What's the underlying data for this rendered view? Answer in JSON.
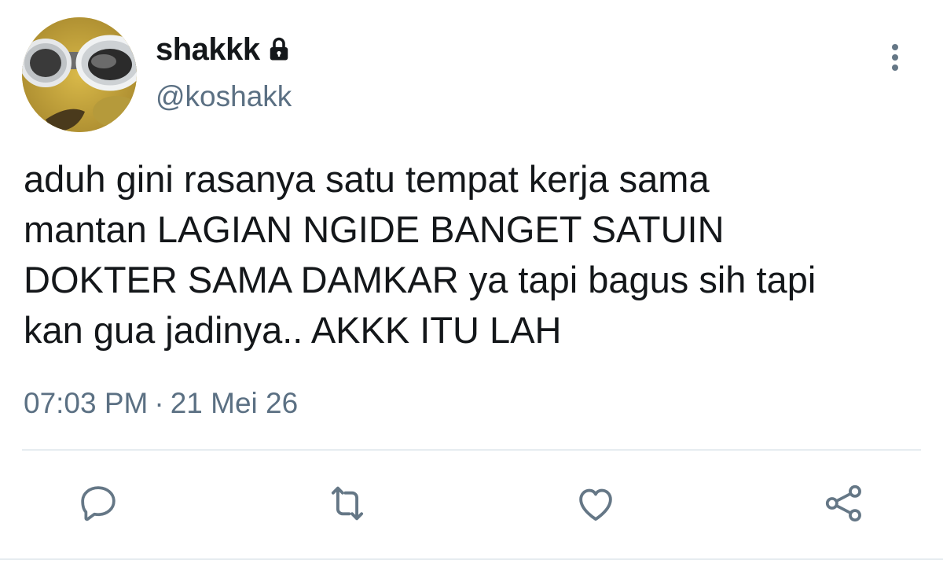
{
  "user": {
    "display_name": "shakkk",
    "handle": "@koshakk",
    "avatar_icon": "avatar-image",
    "protected_icon": "lock-icon"
  },
  "tweet": {
    "text": "aduh gini rasanya satu tempat kerja sama\nmantan LAGIAN NGIDE BANGET SATUIN\nDOKTER SAMA DAMKAR ya tapi bagus sih tapi\nkan gua jadinya.. AKKK ITU LAH",
    "time": "07:03 PM",
    "separator": "·",
    "date": "21 Mei 26"
  },
  "actions": {
    "more": "more-vertical-icon",
    "reply": "reply-icon",
    "retweet": "retweet-icon",
    "like": "heart-icon",
    "share": "share-icon"
  },
  "colors": {
    "text": "#14171a",
    "secondary": "#5b7083",
    "icon": "#657786",
    "divider": "#e6ecf0"
  }
}
